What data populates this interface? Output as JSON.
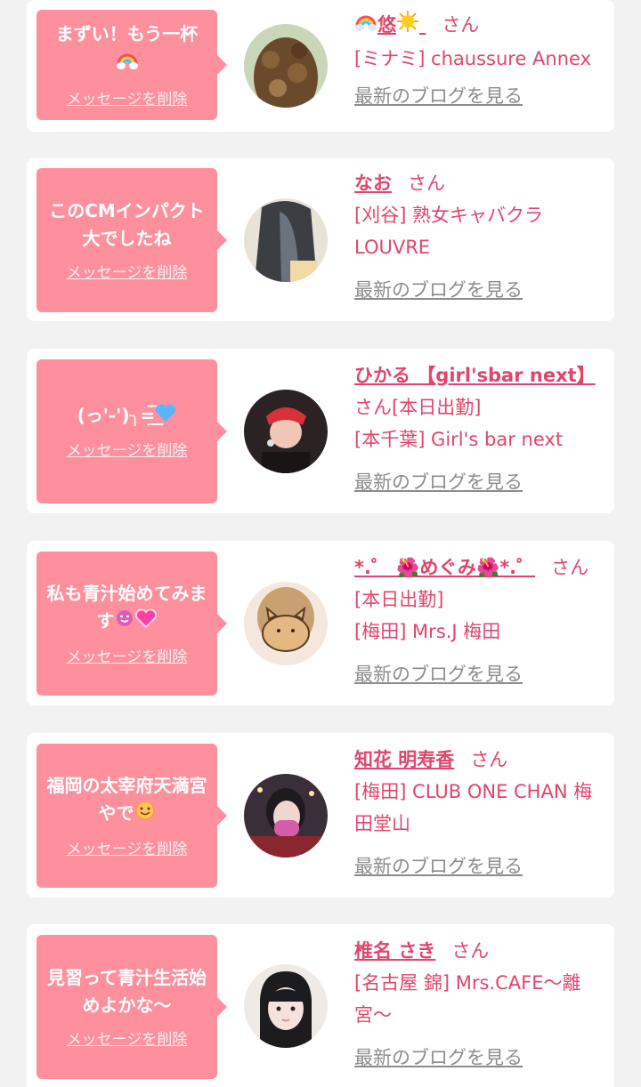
{
  "colors": {
    "accent": "#e2456a",
    "bubble": "#fe909e",
    "link_gray": "#8c8c8c",
    "background": "#f2f2f2"
  },
  "common": {
    "delete_label": "メッセージを削除",
    "blog_label": "最新のブログを見る",
    "suffix": "さん"
  },
  "entries": [
    {
      "message": "まずい！もう一杯",
      "message_icons": [
        "rainbow-cloud-icon"
      ],
      "name": "悠",
      "name_icons": [
        "rainbow-cloud-icon",
        "sun-face-icon"
      ],
      "shop": "[ミナミ] chaussure Annex",
      "avatar": "avatar-curly-hair"
    },
    {
      "message": "このCMインパクト大でしたね",
      "name": "なお",
      "shop": "[刈谷] 熟女キャバクラLOUVRE",
      "avatar": "avatar-long-hair"
    },
    {
      "message": "(っ'-')╮=͟͟͞",
      "message_icons": [
        "blue-heart-icon"
      ],
      "name": "ひかる 【girl'sbar next】",
      "status": "[本日出勤]",
      "shop": "[本千葉] Girl's bar next",
      "avatar": "avatar-red-bow"
    },
    {
      "message": "私も青汁始めてみます",
      "message_icons": [
        "face-tongue-icon",
        "sparkling-heart-icon"
      ],
      "name": "*.゜ 🌺めぐみ🌺*.゜",
      "status": "[本日出勤]",
      "shop": "[梅田] Mrs.J 梅田",
      "avatar": "avatar-cat-sticker"
    },
    {
      "message": "福岡の太宰府天満宮やで",
      "message_icons": [
        "smiling-face-icon"
      ],
      "name": "知花 明寿香",
      "shop": "[梅田] CLUB ONE CHAN 梅田堂山",
      "avatar": "avatar-pink-mask"
    },
    {
      "message": "見習って青汁生活始めよかな〜",
      "name": "椎名 さき",
      "shop": "[名古屋 錦] Mrs.CAFE〜離宮〜",
      "avatar": "avatar-dark-bob"
    }
  ]
}
